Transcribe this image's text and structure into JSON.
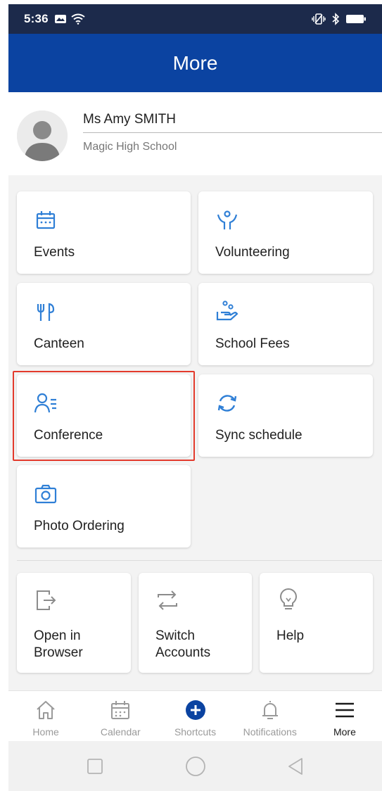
{
  "status_bar": {
    "time": "5:36",
    "icons": [
      "message-icon",
      "wifi-icon",
      "vibrate-icon",
      "bluetooth-icon",
      "battery-icon"
    ]
  },
  "header": {
    "title": "More"
  },
  "profile": {
    "name": "Ms Amy SMITH",
    "school": "Magic High School"
  },
  "tiles": [
    {
      "label": "Events",
      "icon": "calendar-icon"
    },
    {
      "label": "Volunteering",
      "icon": "volunteer-icon"
    },
    {
      "label": "Canteen",
      "icon": "utensils-icon"
    },
    {
      "label": "School Fees",
      "icon": "hand-coins-icon"
    },
    {
      "label": "Conference",
      "icon": "conference-icon"
    },
    {
      "label": "Sync schedule",
      "icon": "sync-icon"
    },
    {
      "label": "Photo Ordering",
      "icon": "camera-icon"
    }
  ],
  "secondary_tiles": [
    {
      "label": "Open in\nBrowser",
      "icon": "open-external-icon"
    },
    {
      "label": "Switch\nAccounts",
      "icon": "switch-icon"
    },
    {
      "label": "Help",
      "icon": "lightbulb-icon"
    }
  ],
  "bottom_nav": [
    {
      "label": "Home",
      "icon": "home-icon"
    },
    {
      "label": "Calendar",
      "icon": "calendar-icon"
    },
    {
      "label": "Shortcuts",
      "icon": "plus-circle-icon"
    },
    {
      "label": "Notifications",
      "icon": "bell-icon"
    },
    {
      "label": "More",
      "icon": "menu-icon",
      "active": true
    }
  ],
  "colors": {
    "status_bar": "#1c2a4b",
    "header": "#0b43a1",
    "accent_icon": "#2f7fd6",
    "highlight": "#e33a2c",
    "shortcut_button": "#0b43a1"
  }
}
